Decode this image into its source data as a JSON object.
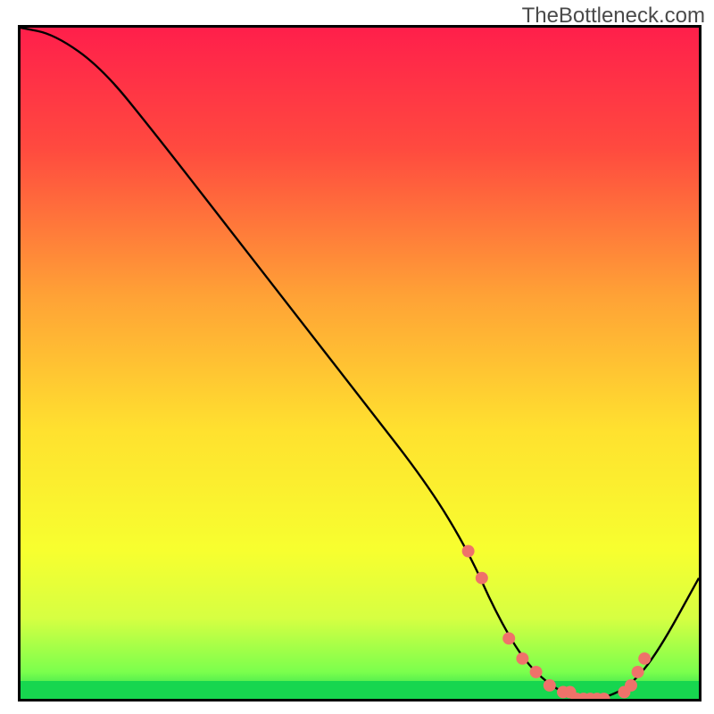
{
  "watermark": {
    "text": "TheBottleneck.com"
  },
  "chart_data": {
    "type": "line",
    "title": "",
    "xlabel": "",
    "ylabel": "",
    "xlim": [
      0,
      100
    ],
    "ylim": [
      0,
      100
    ],
    "grid": false,
    "legend": false,
    "gradient_stops": [
      {
        "offset": 0.0,
        "color": "#ff1f4b"
      },
      {
        "offset": 0.18,
        "color": "#ff4a3f"
      },
      {
        "offset": 0.4,
        "color": "#ffa236"
      },
      {
        "offset": 0.6,
        "color": "#ffe12f"
      },
      {
        "offset": 0.78,
        "color": "#f7ff2f"
      },
      {
        "offset": 0.88,
        "color": "#d6ff42"
      },
      {
        "offset": 0.96,
        "color": "#7bff4d"
      },
      {
        "offset": 1.0,
        "color": "#17d64f"
      }
    ],
    "series": [
      {
        "name": "bottleneck-curve",
        "color": "#000000",
        "width": 2.2,
        "x": [
          0,
          5,
          12,
          20,
          30,
          40,
          50,
          60,
          66,
          70,
          74,
          78,
          82,
          86,
          90,
          94,
          100
        ],
        "y": [
          100,
          99,
          94,
          84,
          71,
          58,
          45,
          32,
          22,
          13,
          6,
          2,
          0,
          0,
          2,
          7,
          18
        ]
      }
    ],
    "markers": {
      "name": "highlight-dots",
      "color": "#ef726a",
      "radius": 7,
      "x": [
        66,
        68,
        72,
        74,
        76,
        78,
        80,
        81,
        82,
        83,
        84,
        85,
        86,
        89,
        90,
        91,
        92
      ],
      "y": [
        22,
        18,
        9,
        6,
        4,
        2,
        1,
        1,
        0,
        0,
        0,
        0,
        0,
        1,
        2,
        4,
        6
      ]
    }
  }
}
